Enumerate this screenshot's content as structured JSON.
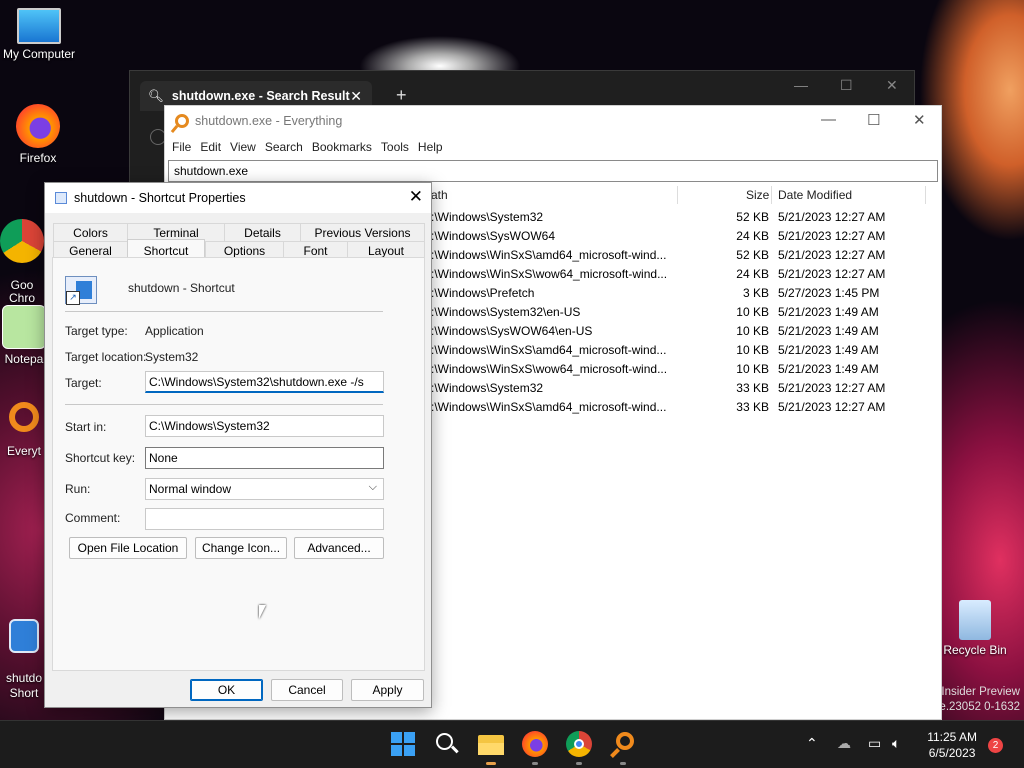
{
  "desktop": {
    "icons": [
      {
        "label": "My Computer"
      },
      {
        "label": "Firefox"
      },
      {
        "label": "Goo\nChro"
      },
      {
        "label": "Notepa"
      },
      {
        "label": "Everyt"
      },
      {
        "label": "shutdo\nShort"
      },
      {
        "label": "Recycle Bin"
      }
    ],
    "insider_line1": "Insider Preview",
    "insider_line2": "se.23052 0-1632"
  },
  "explorer": {
    "tab_title": "shutdown.exe - Search Result",
    "tab_close": "✕",
    "new_tab": "+"
  },
  "everything": {
    "title": "shutdown.exe - Everything",
    "menu": [
      "File",
      "Edit",
      "View",
      "Search",
      "Bookmarks",
      "Tools",
      "Help"
    ],
    "search_value": "shutdown.exe",
    "columns": {
      "path": "ath",
      "size": "Size",
      "date": "Date Modified"
    },
    "rows": [
      {
        "path": ":\\Windows\\System32",
        "size": "52 KB",
        "date": "5/21/2023 12:27 AM"
      },
      {
        "path": ":\\Windows\\SysWOW64",
        "size": "24 KB",
        "date": "5/21/2023 12:27 AM"
      },
      {
        "path": ":\\Windows\\WinSxS\\amd64_microsoft-wind...",
        "size": "52 KB",
        "date": "5/21/2023 12:27 AM"
      },
      {
        "path": ":\\Windows\\WinSxS\\wow64_microsoft-wind...",
        "size": "24 KB",
        "date": "5/21/2023 12:27 AM"
      },
      {
        "path": ":\\Windows\\Prefetch",
        "size": "3 KB",
        "date": "5/27/2023 1:45 PM"
      },
      {
        "path": ":\\Windows\\System32\\en-US",
        "size": "10 KB",
        "date": "5/21/2023 1:49 AM"
      },
      {
        "path": ":\\Windows\\SysWOW64\\en-US",
        "size": "10 KB",
        "date": "5/21/2023 1:49 AM"
      },
      {
        "path": ":\\Windows\\WinSxS\\amd64_microsoft-wind...",
        "size": "10 KB",
        "date": "5/21/2023 1:49 AM"
      },
      {
        "path": ":\\Windows\\WinSxS\\wow64_microsoft-wind...",
        "size": "10 KB",
        "date": "5/21/2023 1:49 AM"
      },
      {
        "path": ":\\Windows\\System32",
        "size": "33 KB",
        "date": "5/21/2023 12:27 AM"
      },
      {
        "path": ":\\Windows\\WinSxS\\amd64_microsoft-wind...",
        "size": "33 KB",
        "date": "5/21/2023 12:27 AM"
      }
    ]
  },
  "props": {
    "title": "shutdown - Shortcut Properties",
    "tabs_back": [
      "Colors",
      "Terminal",
      "Details",
      "Previous Versions"
    ],
    "tabs_front": [
      "General",
      "Shortcut",
      "Options",
      "Font",
      "Layout"
    ],
    "name": "shutdown - Shortcut",
    "target_type_label": "Target type:",
    "target_type_value": "Application",
    "target_location_label": "Target location:",
    "target_location_value": "System32",
    "target_label": "Target:",
    "target_value": "C:\\Windows\\System32\\shutdown.exe -/s",
    "start_in_label": "Start in:",
    "start_in_value": "C:\\Windows\\System32",
    "shortcut_key_label": "Shortcut key:",
    "shortcut_key_value": "None",
    "run_label": "Run:",
    "run_value": "Normal window",
    "comment_label": "Comment:",
    "comment_value": "",
    "btn_open_location": "Open File Location",
    "btn_change_icon": "Change Icon...",
    "btn_advanced": "Advanced...",
    "btn_ok": "OK",
    "btn_cancel": "Cancel",
    "btn_apply": "Apply"
  },
  "taskbar": {
    "time": "11:25 AM",
    "date": "6/5/2023",
    "notifications": "2"
  },
  "colors": {
    "accent": "#0067c0",
    "taskbar": "#1c1c1c"
  }
}
